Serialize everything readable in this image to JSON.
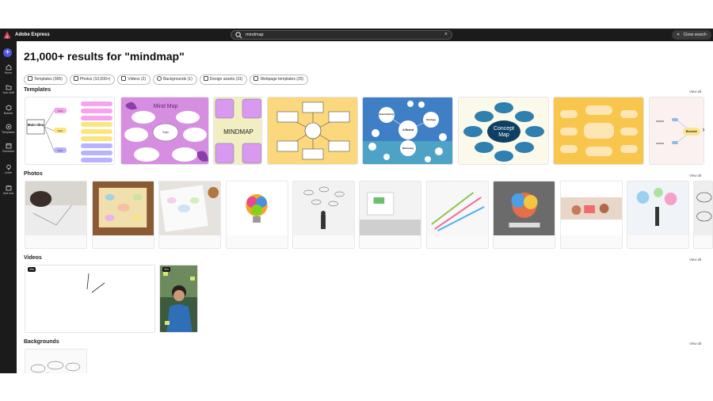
{
  "app": {
    "title": "Adobe Express"
  },
  "search": {
    "query": "mindmap",
    "clear_symbol": "×"
  },
  "close_search": {
    "label": "Close search",
    "symbol": "✕"
  },
  "rail": {
    "plus_symbol": "+",
    "items": [
      {
        "label": "Home",
        "icon": "home-icon"
      },
      {
        "label": "Your stuff",
        "icon": "folder-icon"
      },
      {
        "label": "Brands",
        "icon": "brand-icon"
      },
      {
        "label": "Templates",
        "icon": "templates-icon"
      },
      {
        "label": "Schedule",
        "icon": "calendar-icon"
      },
      {
        "label": "Learn",
        "icon": "lightbulb-icon"
      },
      {
        "label": "Add-ons",
        "icon": "addons-icon"
      }
    ]
  },
  "results": {
    "title": "21,000+ results for \"mindmap\""
  },
  "filters": [
    {
      "label": "Templates (905)",
      "icon": "templates-icon"
    },
    {
      "label": "Photos (10,000+)",
      "icon": "photo-icon"
    },
    {
      "label": "Videos (2)",
      "icon": "video-icon"
    },
    {
      "label": "Backgrounds (1)",
      "icon": "background-icon"
    },
    {
      "label": "Design assets (31)",
      "icon": "shapes-icon"
    },
    {
      "label": "Webpage templates (20)",
      "icon": "webpage-icon"
    }
  ],
  "sections": {
    "templates": {
      "label": "Templates",
      "view_all": "View all"
    },
    "photos": {
      "label": "Photos",
      "view_all": "View all"
    },
    "videos": {
      "label": "Videos",
      "view_all": "View all"
    },
    "backgrounds": {
      "label": "Backgrounds",
      "view_all": "View all"
    }
  },
  "templates": {
    "t1": {
      "main": "Main Idea",
      "topic": "Topic"
    },
    "t2": {
      "title": "Mind Map",
      "topic": "Topic"
    },
    "t3": {
      "title": "MINDMAP"
    },
    "t5": {
      "center": "A Brand",
      "n1": "Brand Identity",
      "n2": "Strategy",
      "n3": "Marketing"
    },
    "t6": {
      "center": "Concept Map"
    },
    "t8": {
      "center": "Business"
    }
  },
  "videos": [
    {
      "duration": "59s"
    },
    {
      "duration": "32s"
    }
  ],
  "colors": {
    "accent": "#5258e4",
    "chrome": "#1b1b1b"
  }
}
